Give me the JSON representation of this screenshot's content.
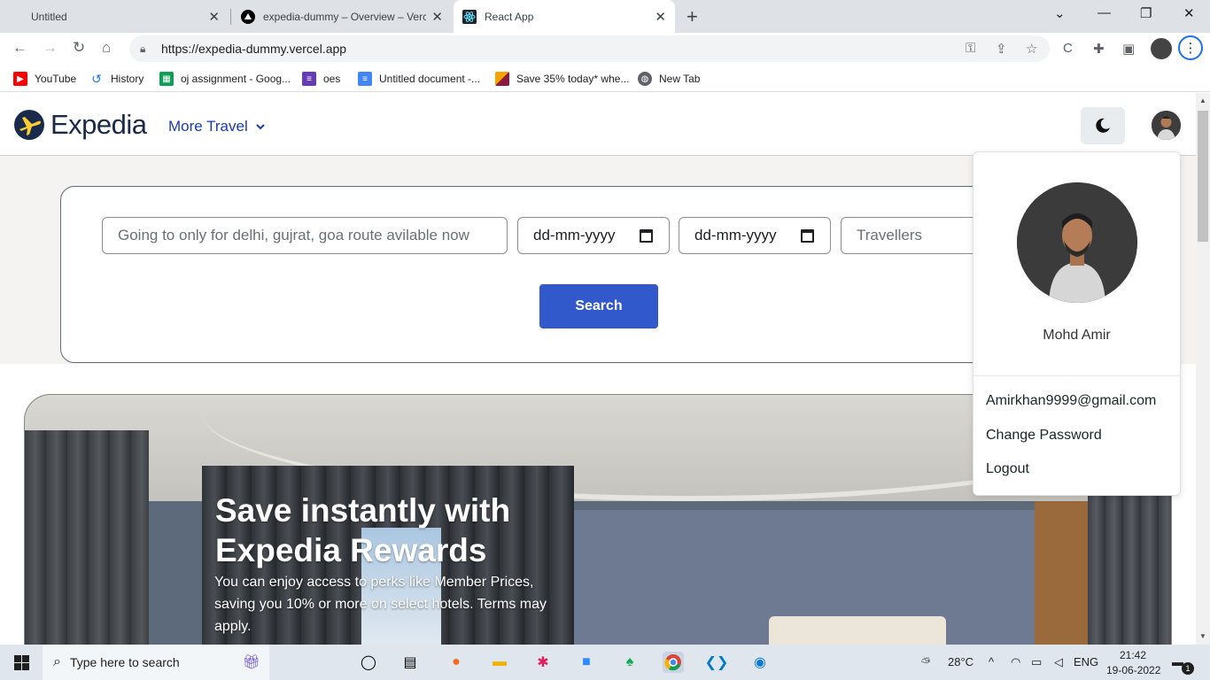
{
  "browser": {
    "tabs": [
      {
        "label": "Untitled",
        "active": false
      },
      {
        "label": "expedia-dummy – Overview – Vercel",
        "active": false
      },
      {
        "label": "React App",
        "active": true
      }
    ],
    "url": "https://expedia-dummy.vercel.app",
    "bookmarks": [
      {
        "label": "YouTube",
        "icon": "youtube-icon",
        "color": "#ff0000"
      },
      {
        "label": "History",
        "icon": "history-icon",
        "color": "#1a73e8"
      },
      {
        "label": "oj assignment - Goog...",
        "icon": "sheets-icon",
        "color": "#0f9d58"
      },
      {
        "label": "oes",
        "icon": "forms-icon",
        "color": "#673ab7"
      },
      {
        "label": "Untitled document -...",
        "icon": "docs-icon",
        "color": "#4285f4"
      },
      {
        "label": "Save 35% today* whe...",
        "icon": "bookmark-site-icon",
        "color": "#8b1a3c"
      },
      {
        "label": "New Tab",
        "icon": "globe-icon",
        "color": "#5f6368"
      }
    ]
  },
  "nav": {
    "brand": "Expedia",
    "more_travel": "More Travel"
  },
  "search": {
    "destination_placeholder": "Going to only for delhi, gujrat, goa route avilable now",
    "checkin": "dd-mm-yyyy",
    "checkout": "dd-mm-yyyy",
    "travellers_placeholder": "Travellers",
    "button": "Search"
  },
  "banner": {
    "title": "Save instantly with Expedia Rewards",
    "subtitle": "You can enjoy access to perks like Member Prices, saving you 10% or more on select hotels. Terms may apply."
  },
  "profile_menu": {
    "name": "Mohd Amir",
    "email": "Amirkhan9999@gmail.com",
    "change_password": "Change Password",
    "logout": "Logout"
  },
  "taskbar": {
    "search_placeholder": "Type here to search",
    "weather": "28°C",
    "language": "ENG",
    "time": "21:42",
    "date": "19-06-2022",
    "notifications": "1"
  },
  "colors": {
    "brand": "#1a2a4b",
    "link": "#1a3cb5",
    "search_button": "#3159cc"
  }
}
